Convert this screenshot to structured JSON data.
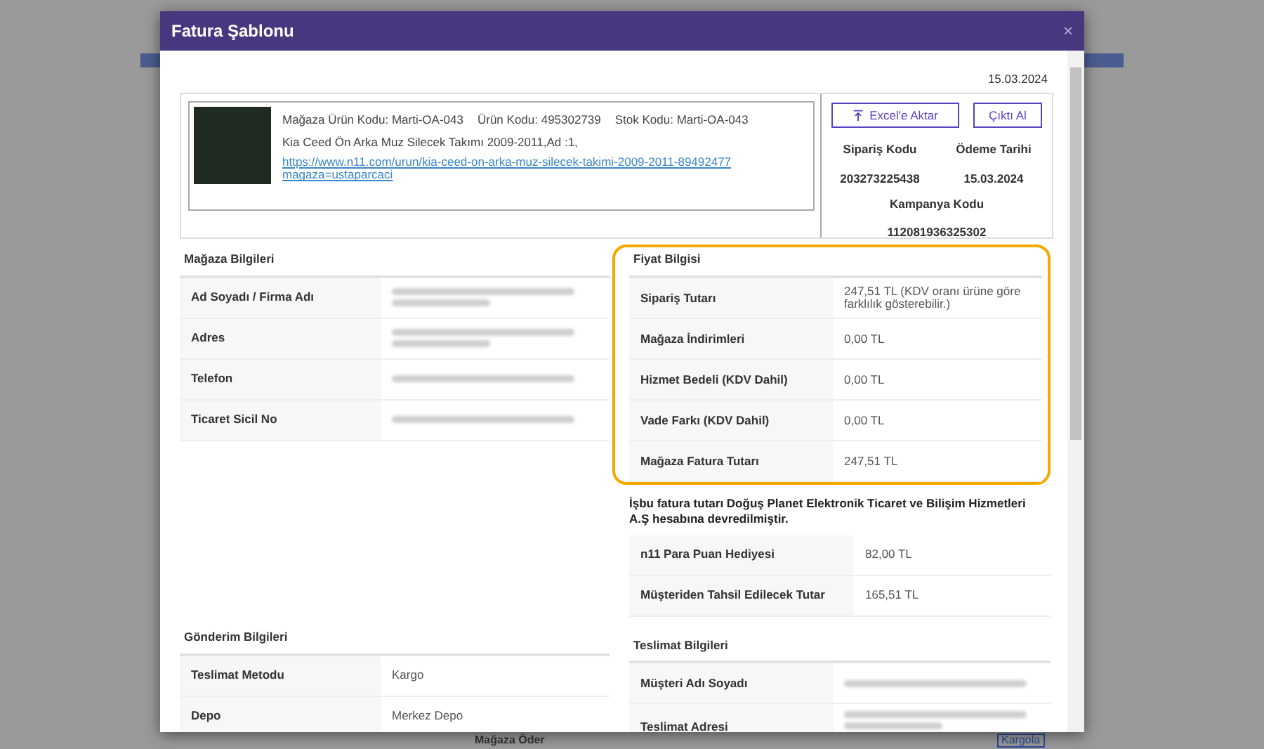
{
  "background_page": {
    "texts": [
      "Mağaza Öder",
      "Kargola"
    ]
  },
  "window": {
    "title": "Fatura Şablonu",
    "close": "×"
  },
  "date": "15.03.2024",
  "product": {
    "meta": [
      {
        "label": "Mağaza Ürün Kodu:",
        "value": "Marti-OA-043"
      },
      {
        "label": "Ürün Kodu:",
        "value": "495302739"
      },
      {
        "label": "Stok Kodu:",
        "value": "Marti-OA-043"
      }
    ],
    "name": "Kia Ceed Ön Arka Muz Silecek Takımı 2009-2011,Ad :1,",
    "link": "https://www.n11.com/urun/kia-ceed-on-arka-muz-silecek-takimi-2009-2011-89492477 magaza=ustaparcaci"
  },
  "actions": [
    {
      "label": "Excel'e Aktar",
      "kind": "export"
    },
    {
      "label": "Çıktı Al",
      "kind": "plain"
    }
  ],
  "order_info": [
    {
      "label": "Sipariş Kodu",
      "value": "203273225438"
    },
    {
      "label": "Ödeme Tarihi",
      "value": "15.03.2024"
    },
    {
      "label": "Kampanya Kodu",
      "value": "112081936325302"
    }
  ],
  "store": {
    "title": "Mağaza Bilgileri",
    "rows": [
      {
        "label": "Ad Soyadı / Firma Adı",
        "redacted": true
      },
      {
        "label": "Adres",
        "redacted": true
      },
      {
        "label": "Telefon",
        "redacted": true
      },
      {
        "label": "Ticaret Sicil No",
        "redacted": true
      }
    ]
  },
  "price": {
    "title": "Fiyat Bilgisi",
    "highlighted": true,
    "rows": [
      {
        "label": "Sipariş Tutarı",
        "value": "247,51 TL  (KDV oranı ürüne göre farklılık gösterebilir.)"
      },
      {
        "label": "Mağaza İndirimleri",
        "value": "0,00 TL"
      },
      {
        "label": "Hizmet Bedeli (KDV Dahil)",
        "value": "0,00 TL"
      },
      {
        "label": "Vade Farkı (KDV Dahil)",
        "value": "0,00 TL"
      },
      {
        "label": "Mağaza Fatura Tutarı",
        "value": "247,51 TL"
      }
    ],
    "note": "İşbu fatura tutarı Doğuş Planet Elektronik Ticaret ve Bilişim Hizmetleri A.Ş hesabına devredilmiştir.",
    "extra_rows": [
      {
        "label": "n11 Para Puan Hediyesi",
        "value": "82,00 TL"
      },
      {
        "label": "Müşteriden Tahsil Edilecek Tutar",
        "value": "165,51 TL"
      }
    ]
  },
  "shipping": {
    "title": "Gönderim Bilgileri",
    "rows": [
      {
        "label": "Teslimat Metodu",
        "value": "Kargo"
      },
      {
        "label": "Depo",
        "value": "Merkez Depo"
      }
    ]
  },
  "delivery": {
    "title": "Teslimat Bilgileri",
    "rows": [
      {
        "label": "Müşteri Adı Soyadı",
        "redacted": true
      },
      {
        "label": "Teslimat Adresi",
        "redacted": true
      }
    ]
  }
}
